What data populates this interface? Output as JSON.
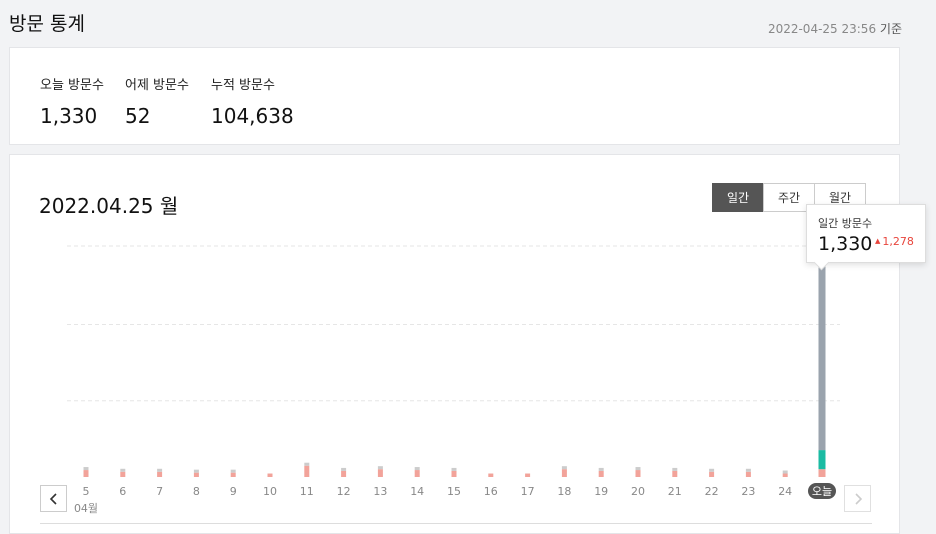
{
  "header": {
    "title": "방문 통계",
    "timestamp": "2022-04-25 23:56",
    "timestamp_suffix": "기준"
  },
  "summary": {
    "today": {
      "label": "오늘 방문수",
      "value": "1,330"
    },
    "yesterday": {
      "label": "어제 방문수",
      "value": "52"
    },
    "total": {
      "label": "누적 방문수",
      "value": "104,638"
    }
  },
  "chart_panel": {
    "date_title": "2022.04.25 월",
    "tabs": [
      {
        "label": "일간",
        "active": true
      },
      {
        "label": "주간",
        "active": false
      },
      {
        "label": "월간",
        "active": false
      }
    ],
    "tooltip": {
      "label": "일간 방문수",
      "value": "1,330",
      "delta": "1,278",
      "delta_color": "#e8453c"
    },
    "month_label": "04월"
  },
  "chart_data": {
    "type": "bar",
    "stacked": true,
    "categories": [
      "5",
      "6",
      "7",
      "8",
      "9",
      "10",
      "11",
      "12",
      "13",
      "14",
      "15",
      "16",
      "17",
      "18",
      "19",
      "20",
      "21",
      "22",
      "23",
      "24",
      "오늘"
    ],
    "series": [
      {
        "color": "#f2a39a",
        "values": [
          40,
          30,
          30,
          25,
          25,
          20,
          65,
          35,
          45,
          40,
          35,
          20,
          20,
          45,
          35,
          40,
          35,
          30,
          30,
          20,
          45
        ]
      },
      {
        "color": "#cccccc",
        "values": [
          10,
          8,
          8,
          7,
          7,
          0,
          15,
          8,
          10,
          10,
          7,
          0,
          0,
          10,
          8,
          8,
          8,
          7,
          7,
          6,
          0
        ]
      },
      {
        "color": "#1bbba3",
        "values": [
          0,
          0,
          0,
          0,
          0,
          0,
          0,
          0,
          0,
          0,
          0,
          0,
          0,
          0,
          0,
          0,
          0,
          0,
          0,
          0,
          110
        ]
      },
      {
        "color": "#9aa3ad",
        "values": [
          0,
          0,
          0,
          0,
          0,
          0,
          0,
          0,
          0,
          0,
          0,
          0,
          0,
          0,
          0,
          0,
          0,
          0,
          0,
          0,
          1175
        ]
      }
    ],
    "ylim": [
      0,
      1330
    ],
    "grid": true,
    "highlight_category": "오늘",
    "highlight_color": "#555555"
  }
}
